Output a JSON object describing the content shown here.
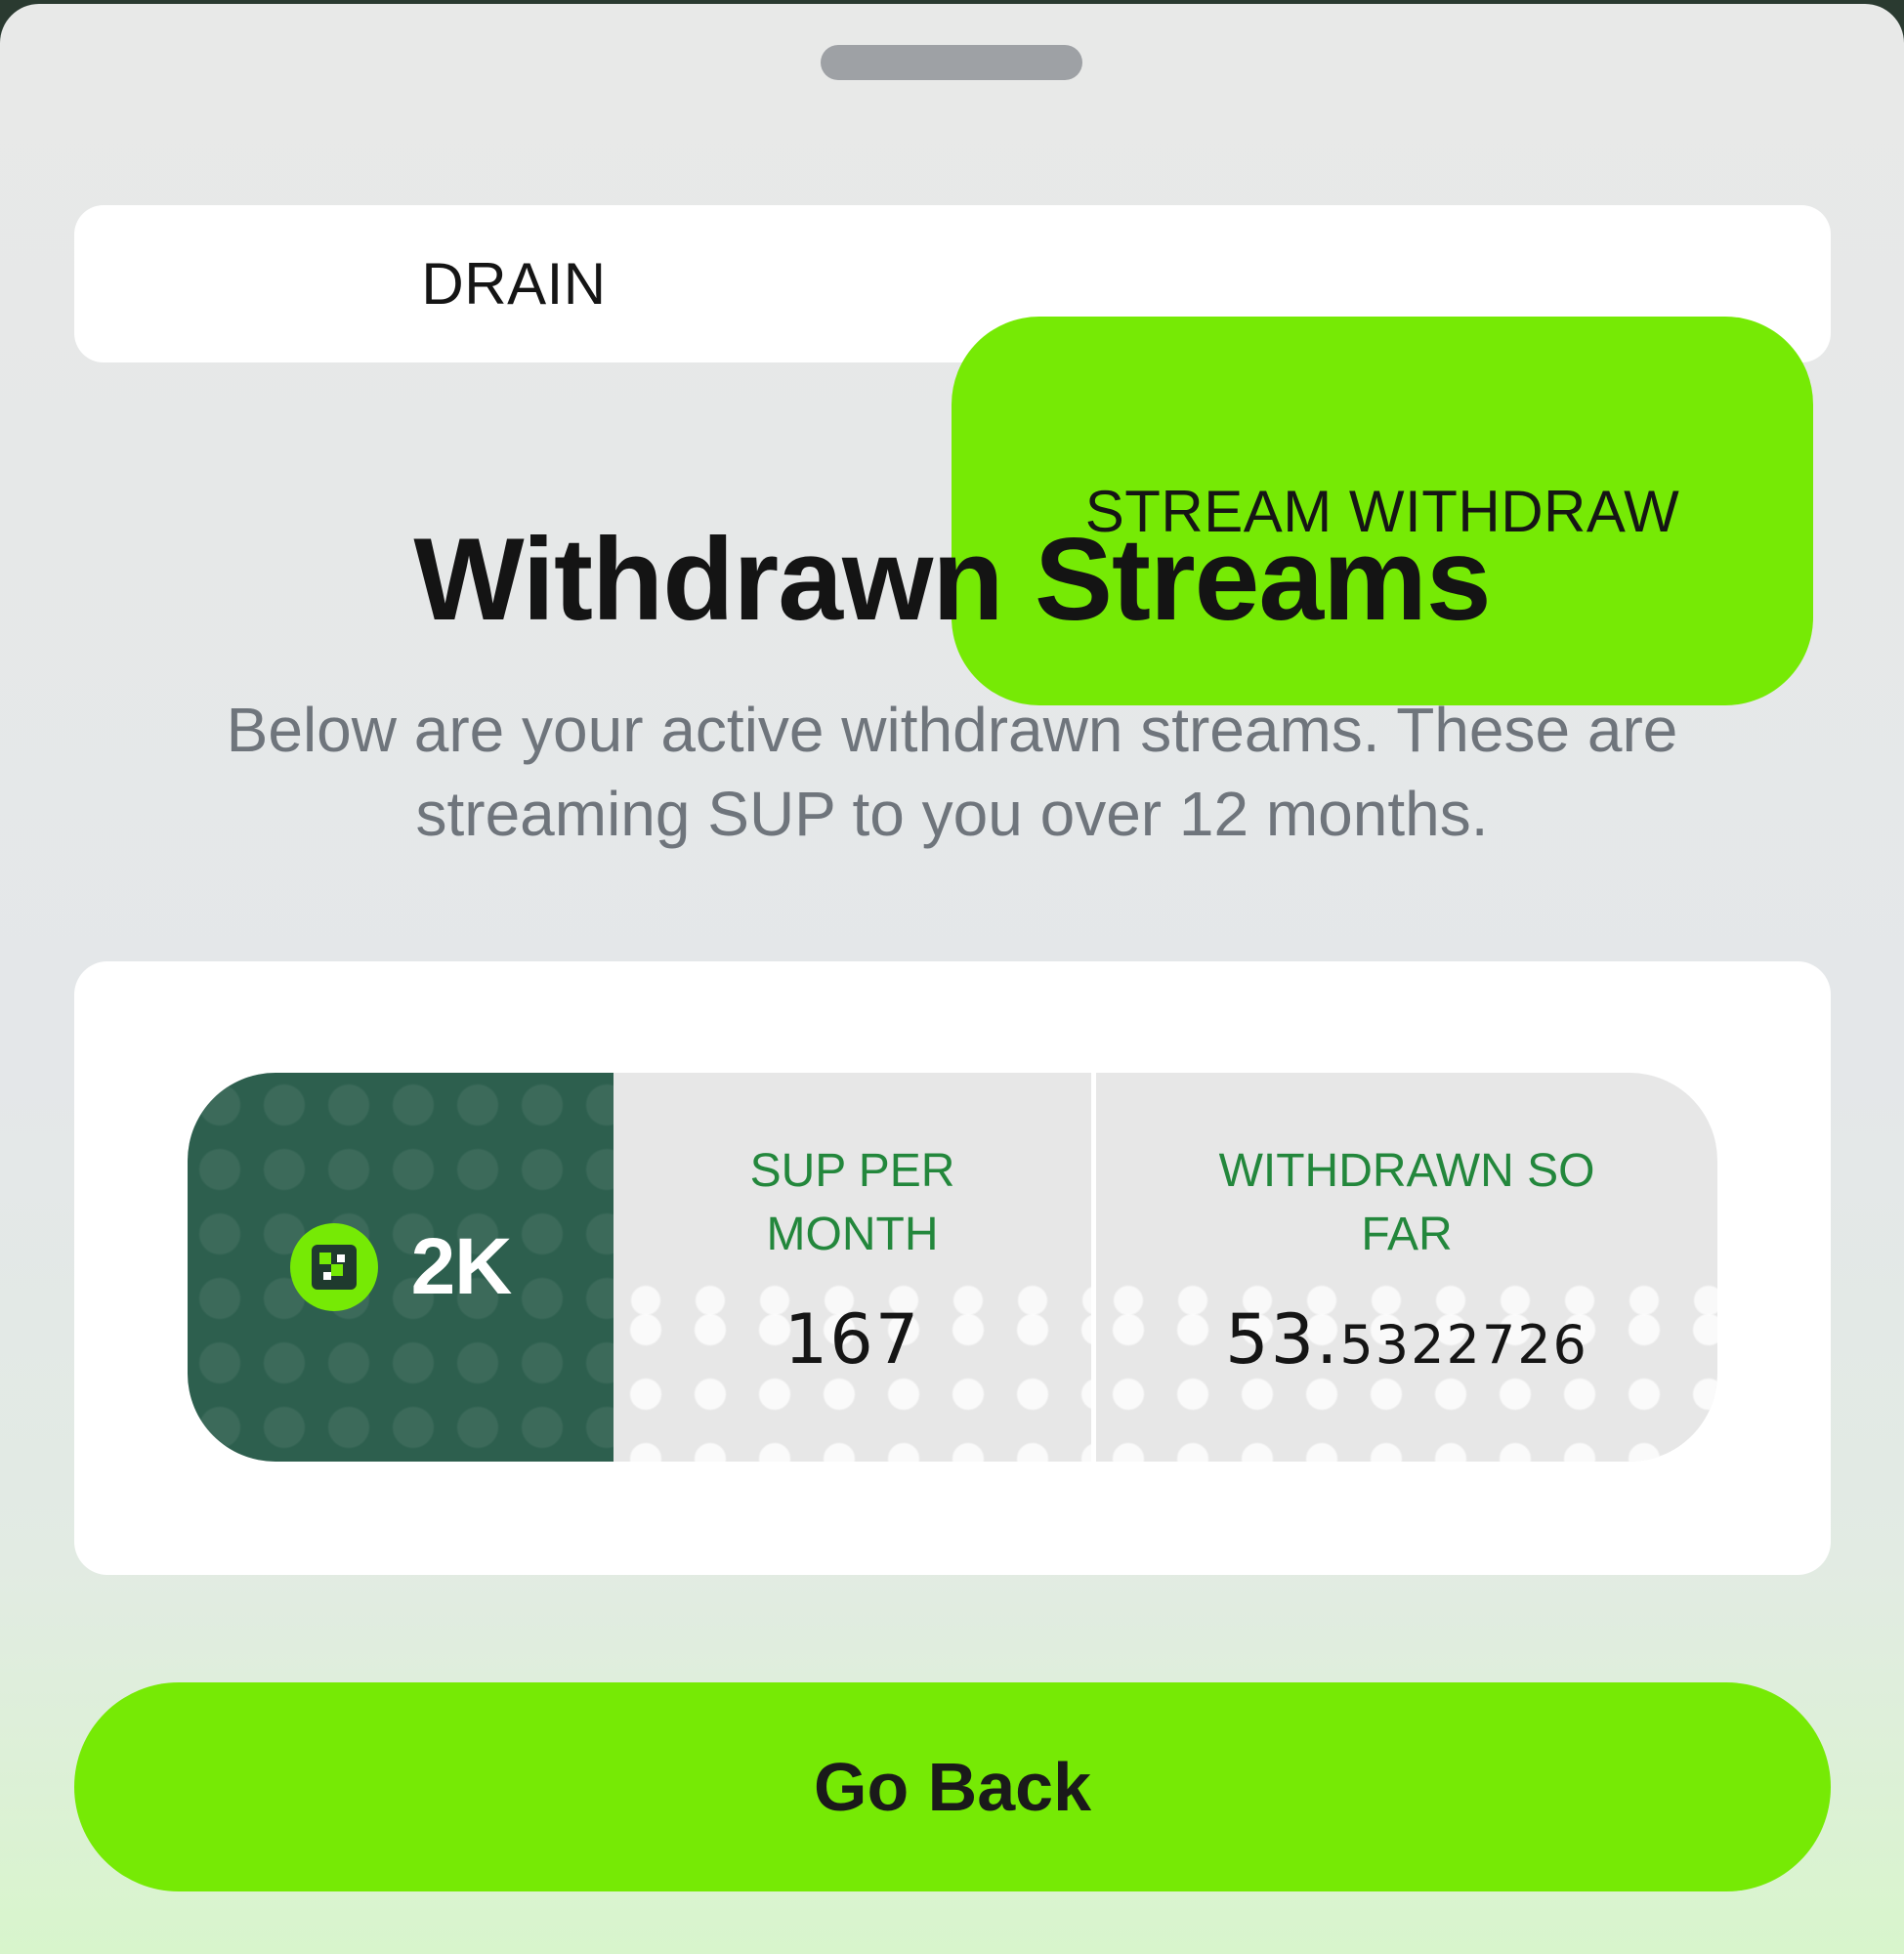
{
  "tabs": [
    {
      "label": "DRAIN",
      "active": false
    },
    {
      "label": "STREAM WITHDRAW",
      "active": true
    }
  ],
  "heading": {
    "title": "Withdrawn Streams",
    "subtitle": "Below are your active withdrawn streams. These are streaming SUP to you over 12 months."
  },
  "streams": [
    {
      "amount": "2K",
      "token_icon": "sup-token-icon",
      "per_month_label": "SUP PER MONTH",
      "per_month_value": "167",
      "withdrawn_label": "WITHDRAWN SO FAR",
      "withdrawn_value_main": "53.",
      "withdrawn_value_decimals": "5322726"
    }
  ],
  "actions": {
    "go_back_label": "Go Back"
  },
  "colors": {
    "accent": "#76ea05",
    "stream_dark": "#2d5f4e",
    "label_green": "#23873c"
  }
}
